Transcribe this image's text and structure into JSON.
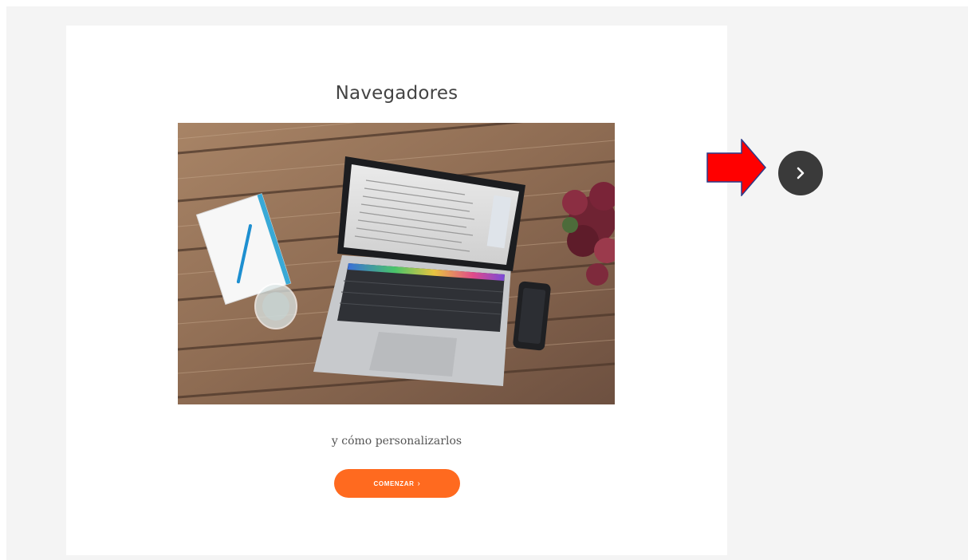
{
  "card": {
    "title": "Navegadores",
    "image_alt": "laptop-on-wooden-desk",
    "subtitle": "y cómo personalizarlos",
    "start_button_label": "COMENZAR",
    "start_button_icon": "chevron-right-icon"
  },
  "navigation": {
    "next_icon": "chevron-right-icon",
    "annotation_icon": "red-arrow-icon"
  },
  "colors": {
    "page_background": "#f4f4f4",
    "card_background": "#ffffff",
    "accent": "#ff6a1f",
    "next_button": "#3a3a3a",
    "annotation_arrow": "#ff0000"
  }
}
